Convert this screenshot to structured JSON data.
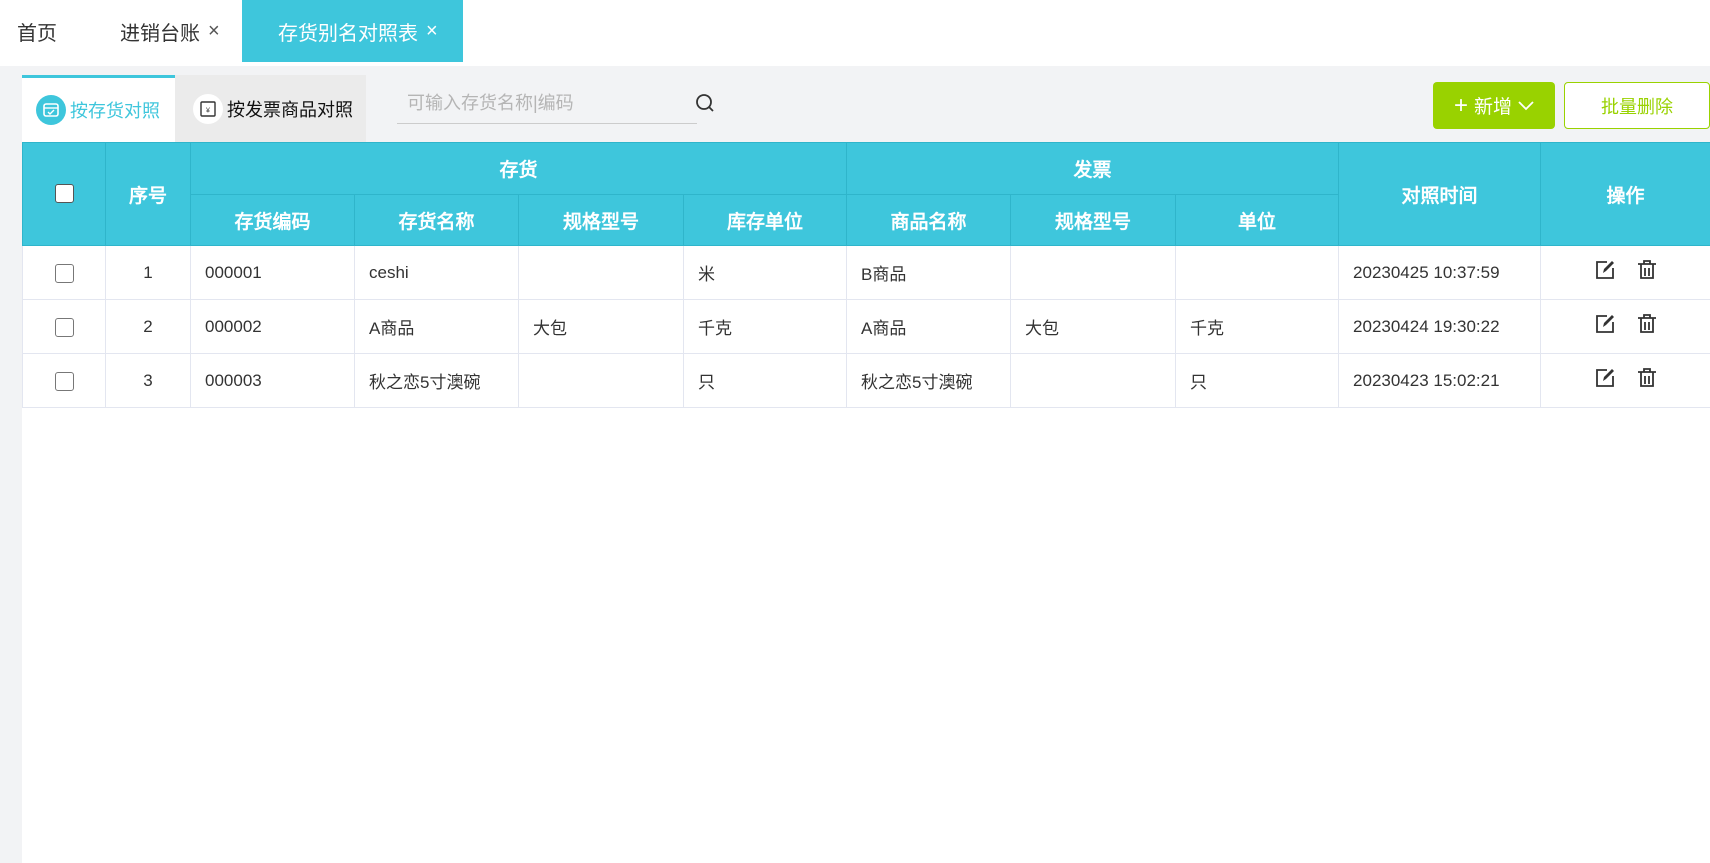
{
  "top_tabs": [
    {
      "label": "首页",
      "closable": false
    },
    {
      "label": "进销台账",
      "closable": true
    },
    {
      "label": "存货别名对照表",
      "closable": true,
      "active": true
    }
  ],
  "close_glyph": "×",
  "sub_tabs": [
    {
      "label": "按存货对照",
      "icon": "inventory-box-icon",
      "active": true
    },
    {
      "label": "按发票商品对照",
      "icon": "invoice-icon"
    }
  ],
  "search": {
    "placeholder": "可输入存货名称|编码",
    "value": ""
  },
  "buttons": {
    "add": "新增",
    "batch_delete": "批量删除"
  },
  "colors": {
    "accent": "#3ec6dc",
    "green": "#99d200"
  },
  "table": {
    "group_headers": {
      "index": "序号",
      "inventory": "存货",
      "invoice": "发票",
      "time": "对照时间",
      "actions": "操作"
    },
    "sub_headers": [
      "存货编码",
      "存货名称",
      "规格型号",
      "库存单位",
      "商品名称",
      "规格型号",
      "单位"
    ],
    "rows": [
      {
        "index": "1",
        "code": "000001",
        "name": "ceshi",
        "spec": "",
        "unit": "米",
        "inv_name": "B商品",
        "inv_spec": "",
        "inv_unit": "",
        "time": "20230425 10:37:59"
      },
      {
        "index": "2",
        "code": "000002",
        "name": "A商品",
        "spec": "大包",
        "unit": "千克",
        "inv_name": "A商品",
        "inv_spec": "大包",
        "inv_unit": "千克",
        "time": "20230424 19:30:22"
      },
      {
        "index": "3",
        "code": "000003",
        "name": "秋之恋5寸澳碗",
        "spec": "",
        "unit": "只",
        "inv_name": "秋之恋5寸澳碗",
        "inv_spec": "",
        "inv_unit": "只",
        "time": "20230423 15:02:21"
      }
    ]
  }
}
